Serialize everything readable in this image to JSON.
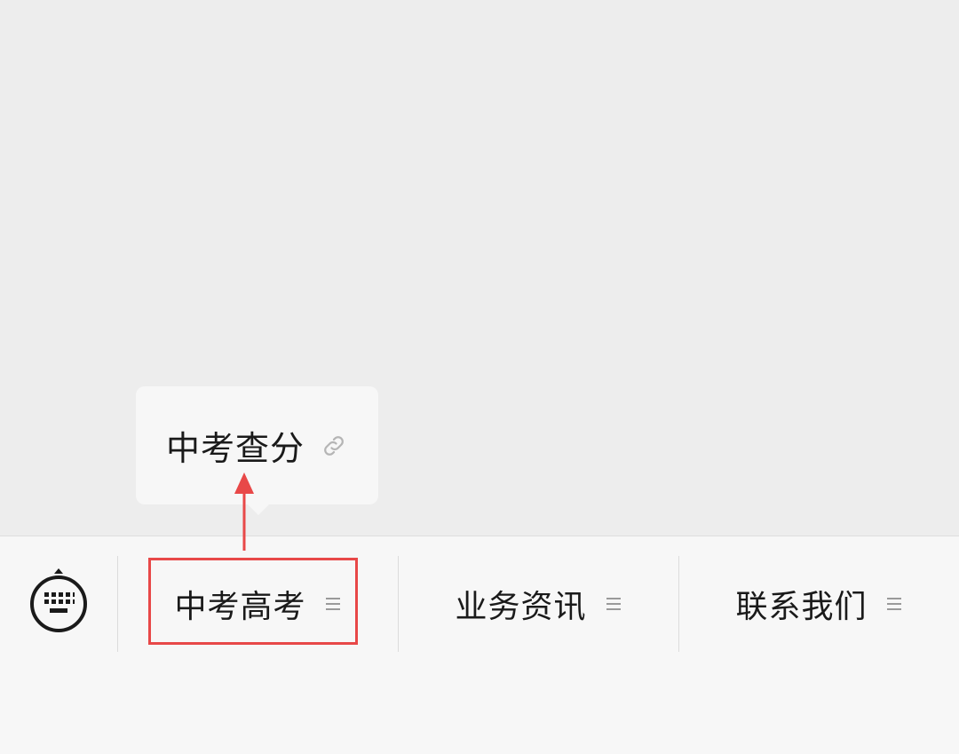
{
  "popup": {
    "label": "中考查分",
    "icon": "link-icon"
  },
  "menu": {
    "keyboard_icon": "keyboard-icon",
    "items": [
      {
        "label": "中考高考",
        "icon": "menu-lines-icon"
      },
      {
        "label": "业务资讯",
        "icon": "menu-lines-icon"
      },
      {
        "label": "联系我们",
        "icon": "menu-lines-icon"
      }
    ]
  },
  "colors": {
    "chat_bg": "#ededed",
    "menu_bg": "#f7f7f7",
    "highlight": "#e84848"
  }
}
